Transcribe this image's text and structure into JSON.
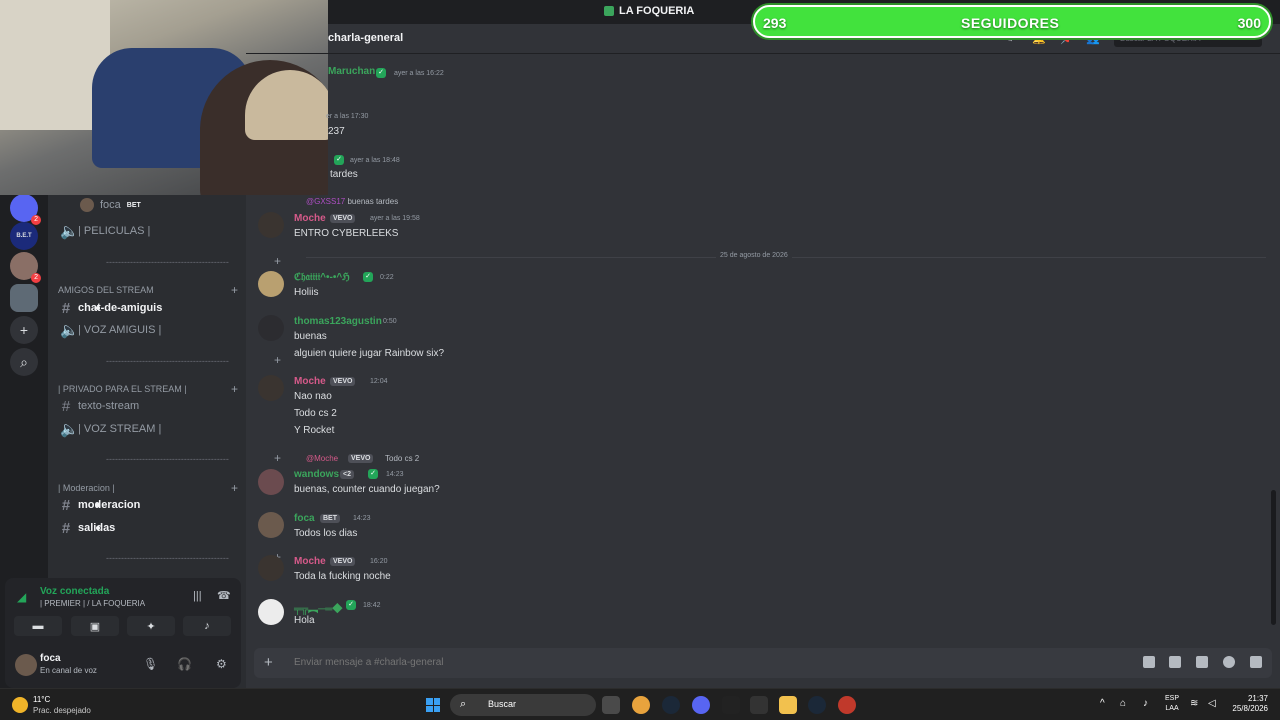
{
  "app": {
    "server_name": "LA FOQUERIA",
    "channel_name": "charla-general"
  },
  "followers_bar": {
    "current": "293",
    "label": "SEGUIDORES",
    "goal": "300"
  },
  "search": {
    "placeholder": "Buscar LA FOQUERIA"
  },
  "servers": [
    {
      "label": "",
      "badge": "2"
    },
    {
      "label": "B.E.T",
      "badge": ""
    },
    {
      "label": "",
      "badge": "2"
    },
    {
      "label": "",
      "badge": ""
    },
    {
      "label": "+",
      "badge": ""
    },
    {
      "label": "⌕",
      "badge": ""
    }
  ],
  "sidebar": {
    "voice_user": {
      "name": "foca",
      "tag": "BET"
    },
    "peliculas": "| PELICULAS |",
    "cat_amigos": "AMIGOS DEL STREAM",
    "chat_amiguis": "chat-de-amiguis",
    "voz_amiguis": "| VOZ AMIGUIS |",
    "cat_privado": "| PRIVADO PARA EL STREAM |",
    "texto_stream": "texto-stream",
    "voz_stream": "| VOZ STREAM |",
    "cat_moderacion": "| Moderacion |",
    "moderacion": "moderacion",
    "salidas": "salidas",
    "separator": "-----------------------------------------"
  },
  "voice_panel": {
    "status": "Voz conectada",
    "channel": "| PREMIER | / LA FOQUERIA",
    "user_name": "foca",
    "user_status": "En canal de voz"
  },
  "messages": [
    {
      "author": "Maruchan",
      "time": "ayer a las 16:22",
      "lines": []
    },
    {
      "author": "",
      "time": "er a las 17:30",
      "lines": [
        "237"
      ]
    },
    {
      "author": "",
      "time": "ayer a las 18:48",
      "lines": [
        "tardes"
      ]
    },
    {
      "reply_to": "@GXSS17",
      "reply_text": "buenas tardes",
      "author": "Moche",
      "tag": "VEVO",
      "time": "ayer a las 19:58",
      "lines": [
        "ENTRO CYBERLEEKS"
      ]
    },
    {
      "author": "ℭ𝔥𝔞𝔦𝔦𝔦𝔦^•-•^ℌ",
      "time": "0:22",
      "lines": [
        "Holiis"
      ]
    },
    {
      "author": "thomas123agustin",
      "time": "0:50",
      "lines": [
        "buenas",
        "alguien quiere jugar Rainbow six?"
      ]
    },
    {
      "author": "Moche",
      "tag": "VEVO",
      "time": "12:04",
      "lines": [
        "Nao nao",
        "Todo cs 2",
        "Y Rocket"
      ]
    },
    {
      "reply_to": "@Moche",
      "reply_tag": "VEVO",
      "reply_text": "Todo cs 2",
      "author": "wandows",
      "tag": "<2",
      "time": "14:23",
      "lines": [
        "buenas, counter cuando juegan?"
      ]
    },
    {
      "author": "foca",
      "tag": "BET",
      "time": "14:23",
      "lines": [
        "Todos los dias"
      ]
    },
    {
      "author": "Moche",
      "tag": "VEVO",
      "time": "16:20",
      "lines": [
        "Toda la fucking noche"
      ]
    },
    {
      "author": "╤╦︻─═◆",
      "time": "18:42",
      "lines": [
        "Hola"
      ]
    }
  ],
  "date_divider": "25 de agosto de 2026",
  "composer": {
    "placeholder": "Enviar mensaje a #charla-general"
  },
  "taskbar": {
    "temp": "11°C",
    "weather": "Prac. despejado",
    "search": "Buscar",
    "lang1": "ESP",
    "lang2": "LAA",
    "time": "21:37",
    "date": "25/8/2026"
  },
  "colors": {
    "discord_bg": "#313338",
    "green_name": "#3ba55c",
    "moche_pink": "#d65a8a",
    "followers_green": "#42e23d"
  }
}
